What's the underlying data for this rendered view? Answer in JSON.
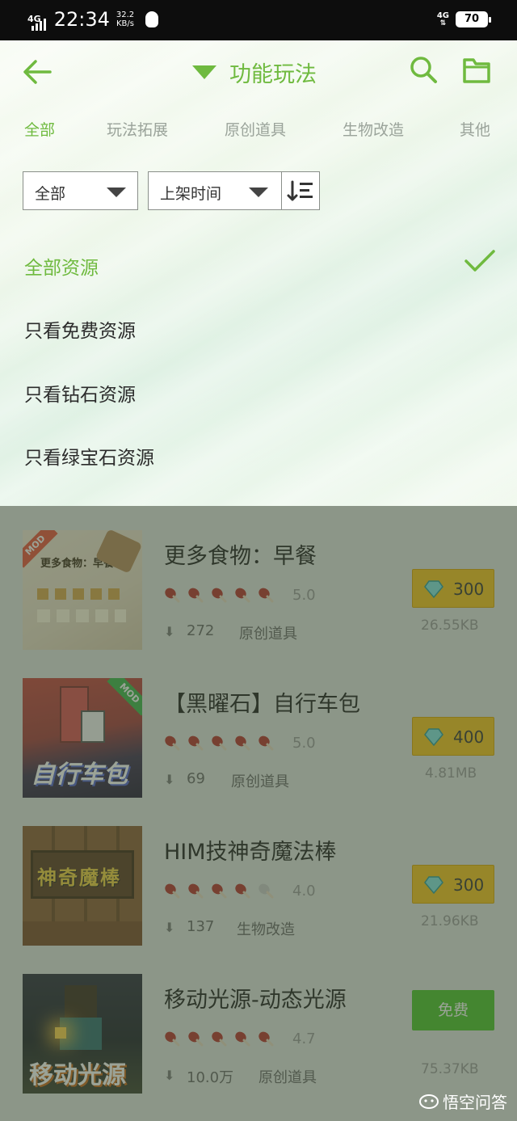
{
  "status_bar": {
    "network_left": "4G",
    "time": "22:34",
    "speed_value": "32.2",
    "speed_unit": "KB/s",
    "network_right": "4G",
    "battery": "70"
  },
  "header": {
    "title": "功能玩法",
    "accent_color": "#6fba3f"
  },
  "tabs": [
    {
      "label": "全部",
      "active": true
    },
    {
      "label": "玩法拓展",
      "active": false
    },
    {
      "label": "原创道具",
      "active": false
    },
    {
      "label": "生物改造",
      "active": false
    },
    {
      "label": "其他",
      "active": false
    }
  ],
  "filters": {
    "type_select": "全部",
    "sort_select": "上架时间"
  },
  "options": [
    {
      "label": "全部资源",
      "selected": true
    },
    {
      "label": "只看免费资源",
      "selected": false
    },
    {
      "label": "只看钻石资源",
      "selected": false
    },
    {
      "label": "只看绿宝石资源",
      "selected": false
    }
  ],
  "items": [
    {
      "title": "更多食物：早餐",
      "rating": "5.0",
      "stars_filled": 5,
      "downloads": "272",
      "category": "原创道具",
      "price": "300",
      "free_label": "",
      "size": "26.55KB",
      "thumb_text": "更多食物：早餐",
      "badge": "MOD"
    },
    {
      "title": "【黑曜石】自行车包",
      "rating": "5.0",
      "stars_filled": 5,
      "downloads": "69",
      "category": "原创道具",
      "price": "400",
      "free_label": "",
      "size": "4.81MB",
      "thumb_text": "自行车包",
      "badge": "MOD"
    },
    {
      "title": "HIM技神奇魔法棒",
      "rating": "4.0",
      "stars_filled": 4,
      "downloads": "137",
      "category": "生物改造",
      "price": "300",
      "free_label": "",
      "size": "21.96KB",
      "thumb_text": "神奇魔棒",
      "badge": ""
    },
    {
      "title": "移动光源-动态光源",
      "rating": "4.7",
      "stars_filled": 5,
      "downloads": "10.0万",
      "category": "原创道具",
      "price": "",
      "free_label": "免费",
      "size": "75.37KB",
      "thumb_text": "移动光源",
      "badge": ""
    }
  ],
  "watermark": "悟空问答"
}
